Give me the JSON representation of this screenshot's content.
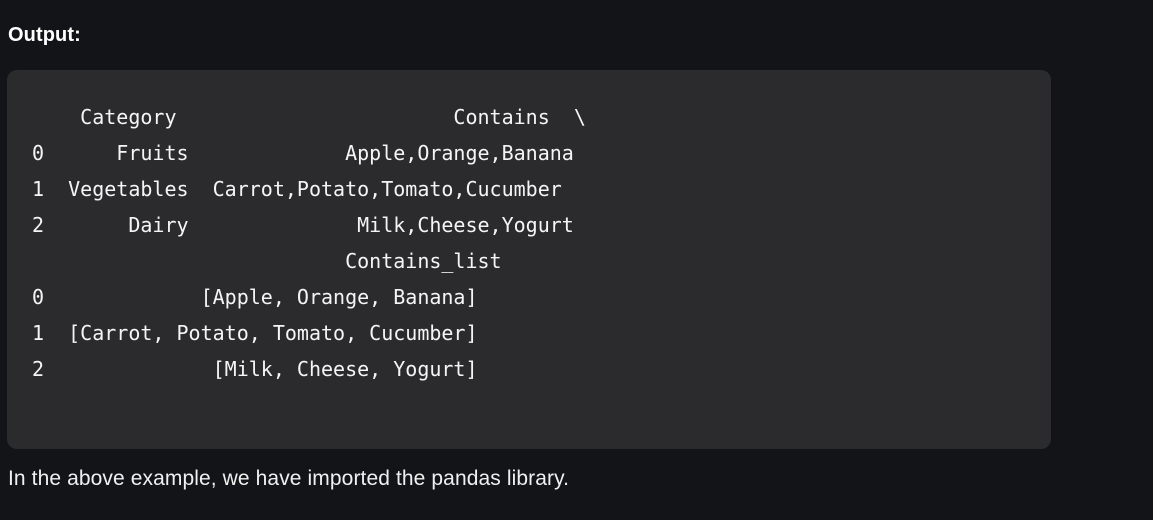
{
  "section": {
    "label": "Output:"
  },
  "output": {
    "lines": [
      "    Category                       Contains  \\",
      "0      Fruits             Apple,Orange,Banana",
      "1  Vegetables  Carrot,Potato,Tomato,Cucumber",
      "2       Dairy              Milk,Cheese,Yogurt",
      "                          Contains_list",
      "0             [Apple, Orange, Banana]",
      "1  [Carrot, Potato, Tomato, Cucumber]",
      "2              [Milk, Cheese, Yogurt]"
    ]
  },
  "caption": {
    "text": "In the above example, we have imported the pandas library."
  }
}
